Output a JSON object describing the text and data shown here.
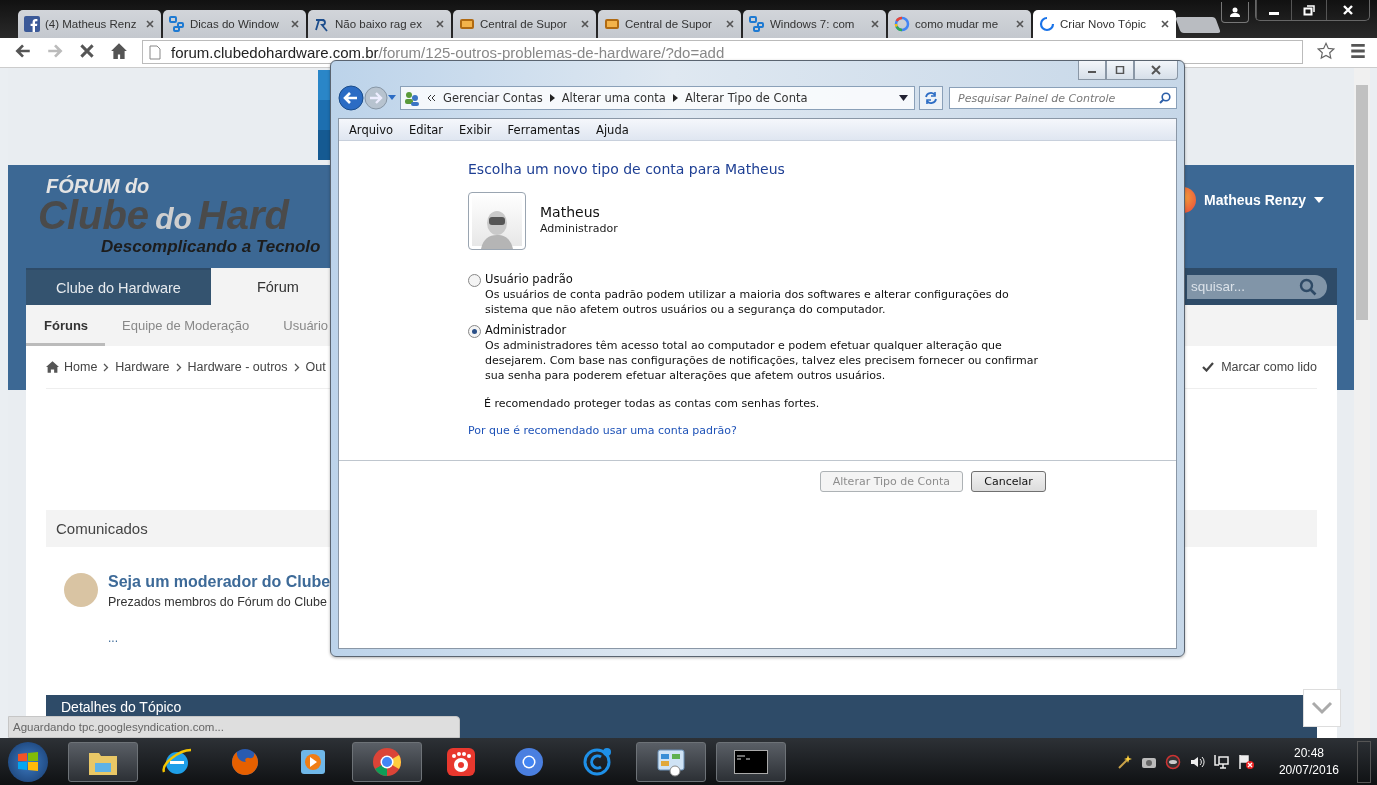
{
  "browser": {
    "tabs": [
      {
        "title": "(4) Matheus Renz",
        "kind": "facebook",
        "selected": false
      },
      {
        "title": "Dicas do Window",
        "kind": "network",
        "selected": false
      },
      {
        "title": "Não baixo rag ex",
        "kind": "script",
        "selected": false
      },
      {
        "title": "Central de Supor",
        "kind": "badge",
        "selected": false
      },
      {
        "title": "Central de Supor",
        "kind": "badge",
        "selected": false
      },
      {
        "title": "Windows 7: com",
        "kind": "network",
        "selected": false
      },
      {
        "title": "como mudar me",
        "kind": "google",
        "selected": false
      },
      {
        "title": "Criar Novo Tópic",
        "kind": "spinner",
        "selected": true
      }
    ],
    "address": {
      "host": "forum.clubedohardware.com.br",
      "path": "/forum/125-outros-problemas-de-hardware/?do=add"
    }
  },
  "page": {
    "logo": {
      "line1": "FÓRUM do",
      "line2_a": "Clube",
      "line2_b": "do",
      "line2_c": "Hard",
      "tagline": "Descomplicando a Tecnolo"
    },
    "user": {
      "name": "Matheus Renzy"
    },
    "nav": [
      {
        "label": "Clube do Hardware",
        "selected": false
      },
      {
        "label": "Fórum",
        "selected": true
      }
    ],
    "search": {
      "placeholder": "squisar..."
    },
    "subnav": [
      {
        "label": "Fóruns",
        "selected": true
      },
      {
        "label": "Equipe de Moderação",
        "selected": false
      },
      {
        "label": "Usuário",
        "selected": false
      }
    ],
    "breadcrumb": [
      "Home",
      "Hardware",
      "Hardware - outros",
      "Out"
    ],
    "mark_read": "Marcar como lido",
    "announcements": {
      "title": "Comunicados",
      "item": {
        "title": "Seja um moderador do Clube",
        "excerpt": "Prezados membros do Fórum do Clube",
        "more": "..."
      }
    },
    "details_title": "Detalhes do Tópico",
    "status": "Aguardando tpc.googlesyndication.com..."
  },
  "dialog": {
    "breadcrumb": [
      "Gerenciar Contas",
      "Alterar uma conta",
      "Alterar Tipo de Conta"
    ],
    "search": {
      "placeholder": "Pesquisar Painel de Controle"
    },
    "menu": [
      "Arquivo",
      "Editar",
      "Exibir",
      "Ferramentas",
      "Ajuda"
    ],
    "heading": "Escolha um novo tipo de conta para Matheus",
    "account": {
      "name": "Matheus",
      "role": "Administrador"
    },
    "options": [
      {
        "label": "Usuário padrão",
        "description": "Os usuários de conta padrão podem utilizar a maioria dos softwares e alterar configurações do sistema que não afetem outros usuários ou a segurança do computador.",
        "selected": false
      },
      {
        "label": "Administrador",
        "description": "Os administradores têm acesso total ao computador e podem efetuar qualquer alteração que desejarem. Com base nas configurações de notificações, talvez eles precisem fornecer ou confirmar sua senha para poderem efetuar alterações que afetem outros usuários.",
        "selected": true
      }
    ],
    "note": "É recomendado proteger todas as contas com senhas fortes.",
    "link": "Por que é recomendado usar uma conta padrão?",
    "buttons": [
      {
        "label": "Alterar Tipo de Conta",
        "disabled": true
      },
      {
        "label": "Cancelar",
        "disabled": false
      }
    ]
  },
  "taskbar": {
    "apps": [
      {
        "kind": "explorer",
        "open": true
      },
      {
        "kind": "ie",
        "open": false
      },
      {
        "kind": "firefox",
        "open": false
      },
      {
        "kind": "media",
        "open": false
      },
      {
        "kind": "chrome",
        "open": true
      },
      {
        "kind": "redapp",
        "open": false
      },
      {
        "kind": "chromeblue",
        "open": false
      },
      {
        "kind": "bluec",
        "open": false
      },
      {
        "kind": "controlpanel",
        "open": true
      },
      {
        "kind": "console",
        "open": true
      }
    ],
    "time": "20:48",
    "date": "20/07/2016"
  }
}
